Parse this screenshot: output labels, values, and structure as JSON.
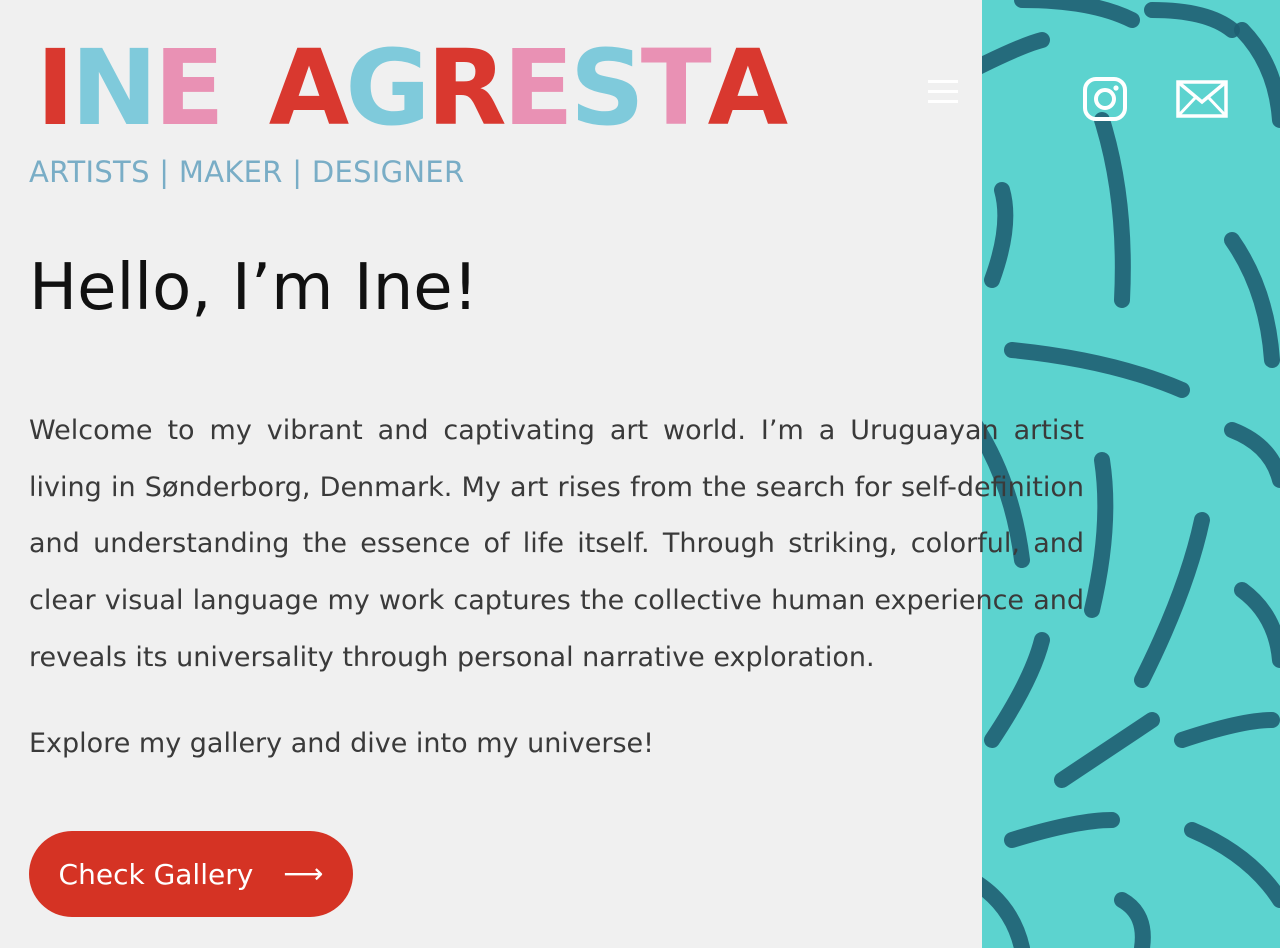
{
  "brand": {
    "logo_letters": [
      {
        "char": "I",
        "color": "#d9382f"
      },
      {
        "char": "N",
        "color": "#7fcadb"
      },
      {
        "char": "E",
        "color": "#e991b4"
      },
      {
        "char": "A",
        "color": "#d9382f"
      },
      {
        "char": "G",
        "color": "#7fcadb"
      },
      {
        "char": "R",
        "color": "#d9382f"
      },
      {
        "char": "E",
        "color": "#e991b4"
      },
      {
        "char": "S",
        "color": "#7fcadb"
      },
      {
        "char": "T",
        "color": "#e991b4"
      },
      {
        "char": "A",
        "color": "#d9382f"
      }
    ],
    "logo_text": "INE AGRESTA",
    "tagline": "ARTISTS | MAKER | DESIGNER"
  },
  "header": {
    "icons": [
      "menu-icon",
      "instagram-icon",
      "email-icon"
    ]
  },
  "hero": {
    "title": "Hello, I’m Ine!",
    "intro": "Welcome to my vibrant and captivating art world. I’m a Uruguayan artist living in Sønderborg, Denmark. My art rises from the search for self-definition and understanding the essence of life itself. Through striking, colorful, and clear visual language my work captures the collective human experience and reveals its universality through personal narrative exploration.",
    "explore": "Explore my gallery and dive into my universe!",
    "cta_label": "Check Gallery",
    "cta_icon": "arrow-right-icon"
  },
  "colors": {
    "background": "#f0f0f0",
    "cta": "#d53324",
    "tagline": "#79adc6",
    "texture_bg": "#5cd3cf",
    "texture_yarn": "#1f5f72"
  }
}
